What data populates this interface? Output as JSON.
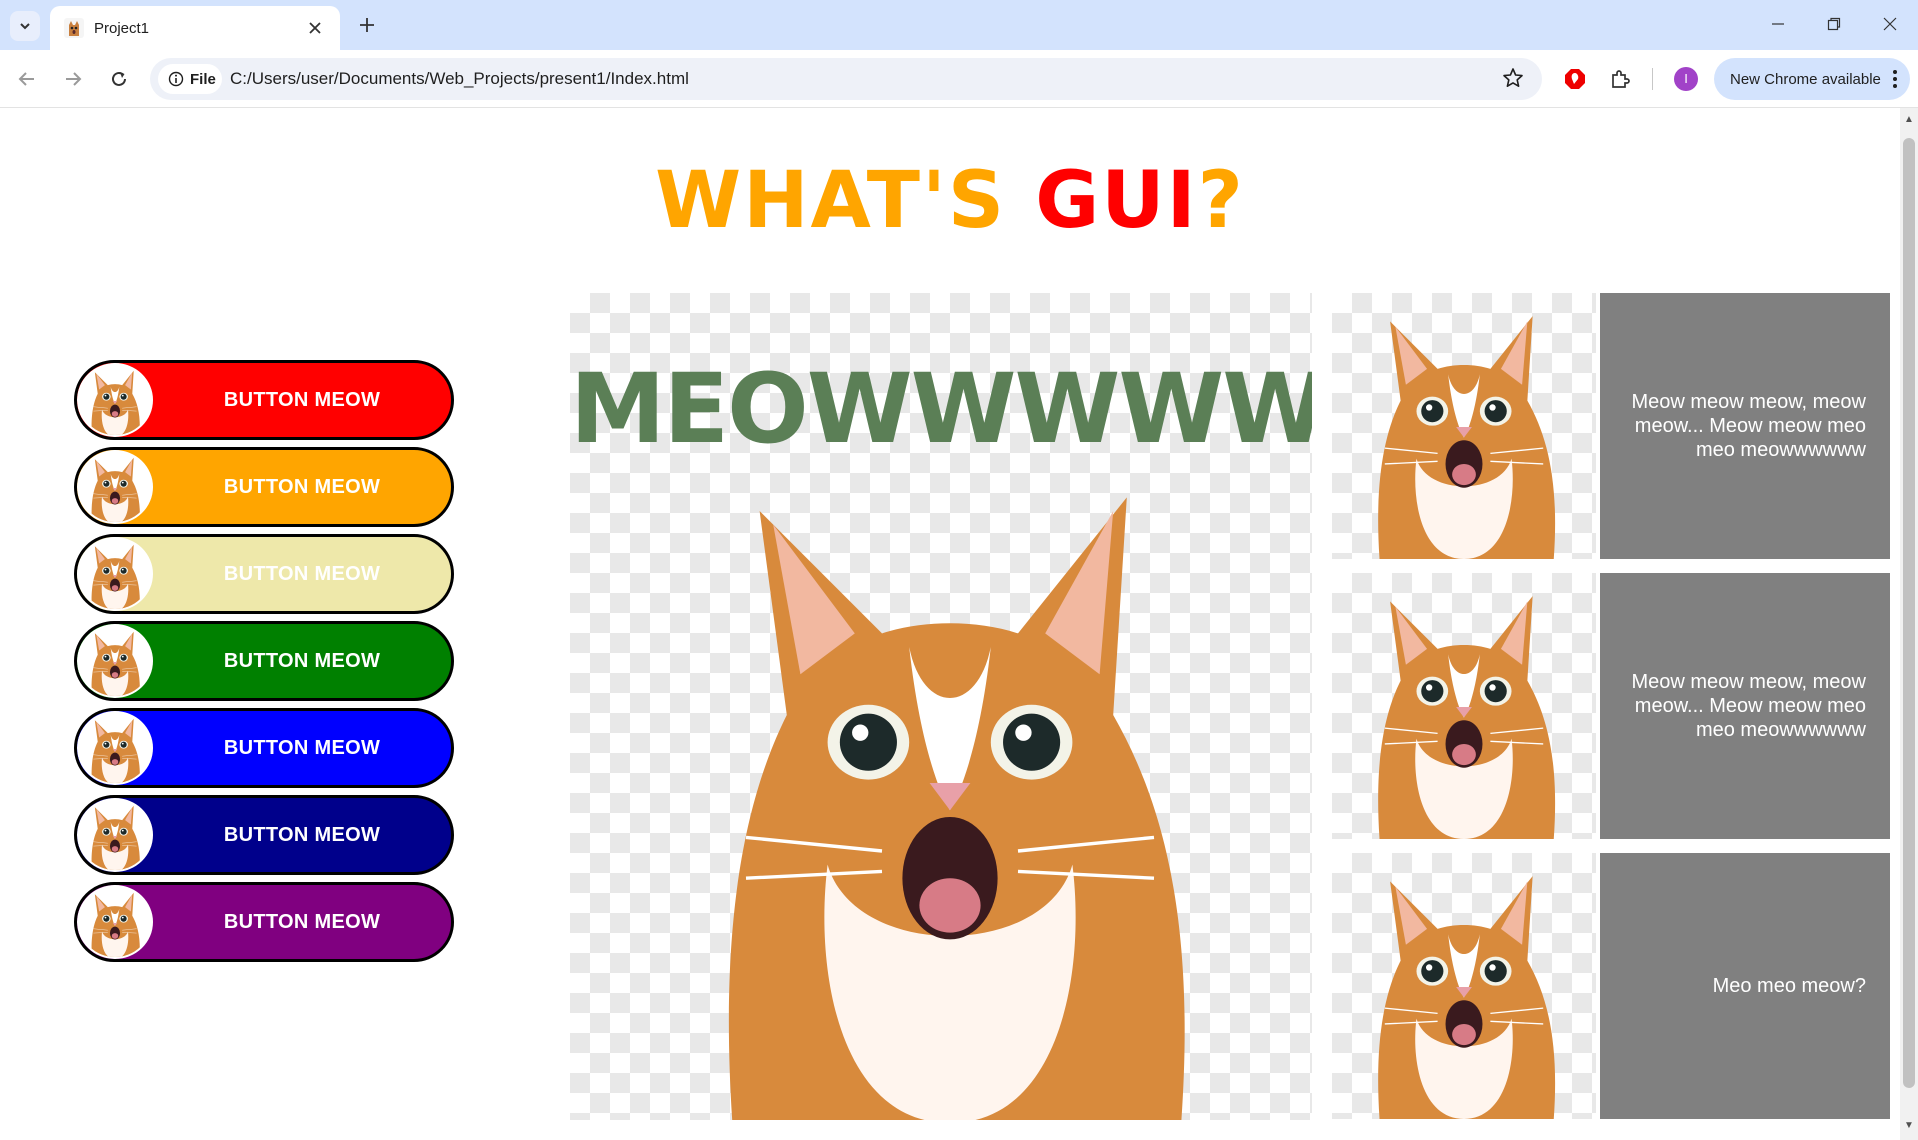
{
  "browser": {
    "tab_title": "Project1",
    "site_chip": "File",
    "url": "C:/Users/user/Documents/Web_Projects/present1/Index.html",
    "update_label": "New Chrome available",
    "avatar_letter": "I"
  },
  "page": {
    "headline_part1": "WHAT'S ",
    "headline_part2": "GUI",
    "headline_part3": "?",
    "hero_text": "MEOWWWWW~!",
    "buttons": [
      {
        "label": "BUTTON MEOW",
        "color": "#ff0000"
      },
      {
        "label": "BUTTON MEOW",
        "color": "#ffa500"
      },
      {
        "label": "BUTTON MEOW",
        "color": "#eee8aa"
      },
      {
        "label": "BUTTON MEOW",
        "color": "#008000"
      },
      {
        "label": "BUTTON MEOW",
        "color": "#0000ff"
      },
      {
        "label": "BUTTON MEOW",
        "color": "#00008b"
      },
      {
        "label": "BUTTON MEOW",
        "color": "#800080"
      }
    ],
    "cards": [
      {
        "text": "Meow meow meow, meow meow... Meow meow meo meo meowwwwww"
      },
      {
        "text": "Meow meow meow, meow meow... Meow meow meo meo meowwwwww"
      },
      {
        "text": "Meo meo meow?"
      }
    ]
  },
  "colors": {
    "headline_orange": "#ffa500",
    "headline_red": "#ff0000",
    "hero_text": "#5b7f56",
    "card_bg": "#808080"
  },
  "icons": [
    "tab-list-icon",
    "cat-favicon-icon",
    "close-icon",
    "plus-icon",
    "minimize-icon",
    "restore-icon",
    "back-icon",
    "forward-icon",
    "reload-icon",
    "info-icon",
    "star-icon",
    "adblock-icon",
    "extensions-icon",
    "menu-dots-icon"
  ]
}
